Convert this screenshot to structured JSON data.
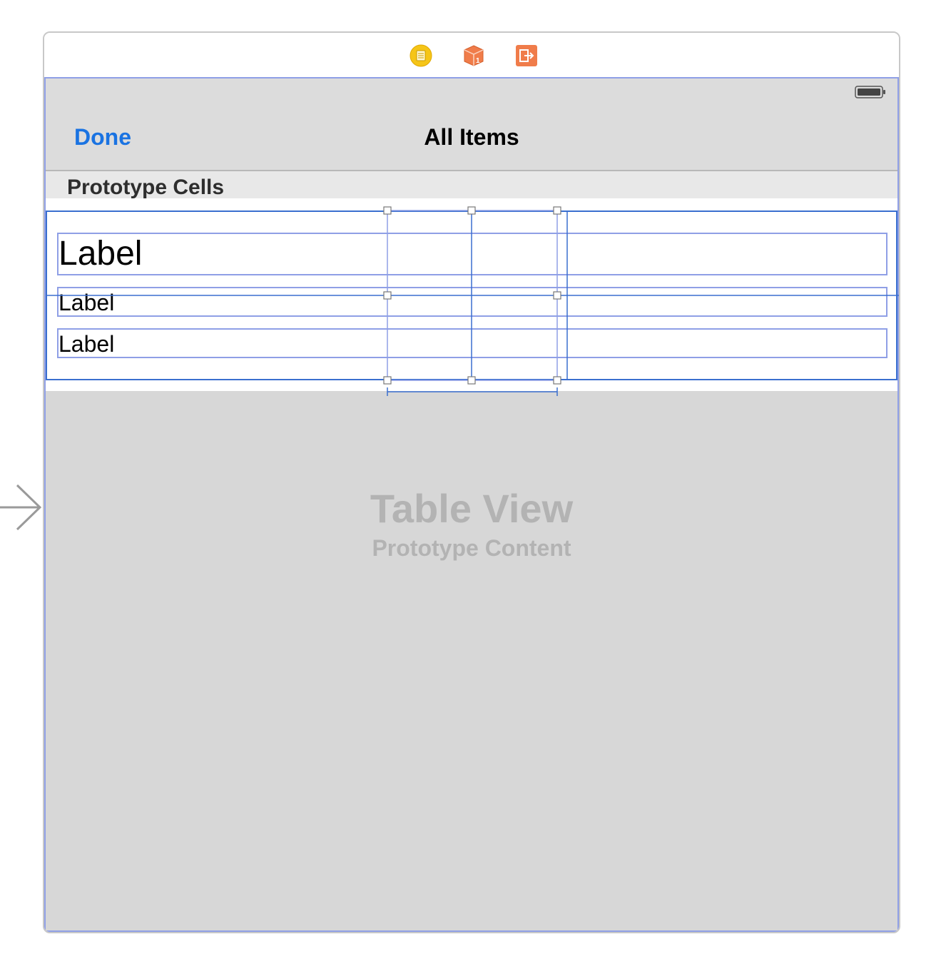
{
  "scene_dock": {
    "icons": [
      {
        "name": "view-controller-icon",
        "color": "#f5c518"
      },
      {
        "name": "first-responder-icon",
        "color": "#f07c4a"
      },
      {
        "name": "exit-icon",
        "color": "#f07c4a"
      }
    ]
  },
  "nav": {
    "left_button": "Done",
    "title": "All Items"
  },
  "table": {
    "section_header": "Prototype Cells",
    "cell_labels": [
      "Label",
      "Label",
      "Label"
    ],
    "placeholder_title": "Table View",
    "placeholder_subtitle": "Prototype Content"
  },
  "colors": {
    "accent": "#1a73e2",
    "selection": "#3a6fcf",
    "constraint": "#8f9fe6"
  }
}
